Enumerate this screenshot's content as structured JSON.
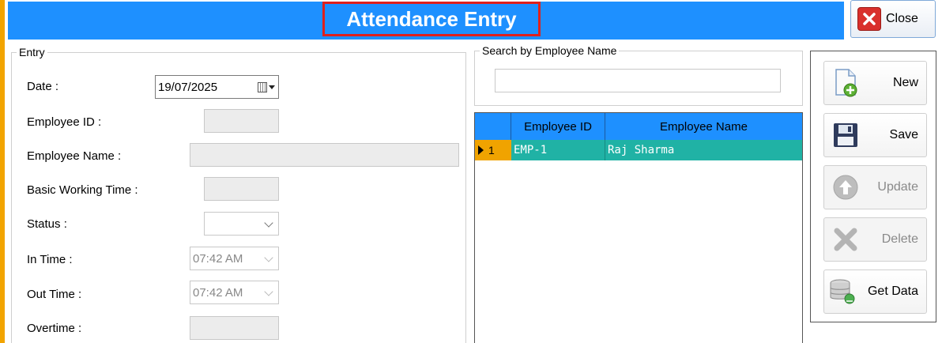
{
  "window": {
    "title": "Attendance Entry",
    "close_label": "Close"
  },
  "entry": {
    "legend": "Entry",
    "date": {
      "label": "Date :",
      "value": "19/07/2025"
    },
    "employee_id": {
      "label": "Employee ID :",
      "value": ""
    },
    "employee_name": {
      "label": "Employee Name :",
      "value": ""
    },
    "basic_working_time": {
      "label": "Basic Working Time :",
      "value": ""
    },
    "status": {
      "label": "Status :",
      "value": ""
    },
    "in_time": {
      "label": "In Time :",
      "value": "07:42 AM"
    },
    "out_time": {
      "label": "Out Time :",
      "value": "07:42 AM"
    },
    "overtime": {
      "label": "Overtime :",
      "value": ""
    }
  },
  "search": {
    "legend": "Search by Employee Name",
    "value": ""
  },
  "grid": {
    "columns": [
      "Employee ID",
      "Employee Name"
    ],
    "rows": [
      {
        "index": "1",
        "employee_id": "EMP-1",
        "employee_name": "Raj Sharma"
      }
    ]
  },
  "toolbar": {
    "new_label": "New",
    "save_label": "Save",
    "update_label": "Update",
    "delete_label": "Delete",
    "get_data_label": "Get Data"
  },
  "colors": {
    "accent": "#1e90ff",
    "row_selected": "#20b2a5",
    "row_header": "#f0a300",
    "title_border": "#e0201c"
  }
}
